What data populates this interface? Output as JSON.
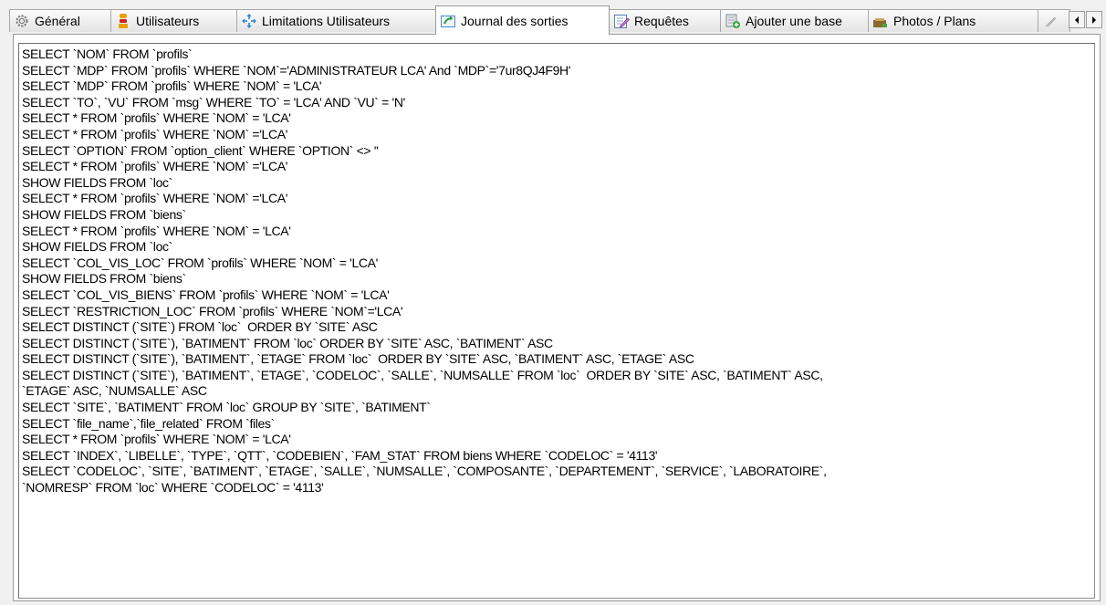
{
  "tabs": [
    {
      "label": "Général",
      "icon": "gear-icon"
    },
    {
      "label": "Utilisateurs",
      "icon": "user-icon"
    },
    {
      "label": "Limitations Utilisateurs",
      "icon": "limit-arrows-icon"
    },
    {
      "label": "Journal des sorties",
      "icon": "export-arrow-icon",
      "active": true
    },
    {
      "label": "Requêtes",
      "icon": "edit-pencil-icon"
    },
    {
      "label": "Ajouter une base",
      "icon": "add-database-icon"
    },
    {
      "label": "Photos / Plans",
      "icon": "photo-icon"
    }
  ],
  "log_lines": [
    "SELECT `NOM` FROM `profils`",
    "SELECT `MDP` FROM `profils` WHERE `NOM`='ADMINISTRATEUR LCA' And `MDP`='7ur8QJ4F9H'",
    "SELECT `MDP` FROM `profils` WHERE `NOM` = 'LCA'",
    "SELECT `TO`, `VU` FROM `msg` WHERE `TO` = 'LCA' AND `VU` = 'N'",
    "SELECT * FROM `profils` WHERE `NOM` = 'LCA'",
    "SELECT * FROM `profils` WHERE `NOM` ='LCA'",
    "SELECT `OPTION` FROM `option_client` WHERE `OPTION` <> ''",
    "SELECT * FROM `profils` WHERE `NOM` ='LCA'",
    "SHOW FIELDS FROM `loc`",
    "SELECT * FROM `profils` WHERE `NOM` ='LCA'",
    "SHOW FIELDS FROM `biens`",
    "SELECT * FROM `profils` WHERE `NOM` = 'LCA'",
    "SHOW FIELDS FROM `loc`",
    "SELECT `COL_VIS_LOC` FROM `profils` WHERE `NOM` = 'LCA'",
    "SHOW FIELDS FROM `biens`",
    "SELECT `COL_VIS_BIENS` FROM `profils` WHERE `NOM` = 'LCA'",
    "SELECT `RESTRICTION_LOC` FROM `profils` WHERE `NOM`='LCA'",
    "SELECT DISTINCT (`SITE`) FROM `loc`  ORDER BY `SITE` ASC",
    "SELECT DISTINCT (`SITE`), `BATIMENT` FROM `loc` ORDER BY `SITE` ASC, `BATIMENT` ASC",
    "SELECT DISTINCT (`SITE`), `BATIMENT`, `ETAGE` FROM `loc`  ORDER BY `SITE` ASC, `BATIMENT` ASC, `ETAGE` ASC",
    "SELECT DISTINCT (`SITE`), `BATIMENT`, `ETAGE`, `CODELOC`, `SALLE`, `NUMSALLE` FROM `loc`  ORDER BY `SITE` ASC, `BATIMENT` ASC,",
    "`ETAGE` ASC, `NUMSALLE` ASC",
    "SELECT `SITE`, `BATIMENT` FROM `loc` GROUP BY `SITE`, `BATIMENT`",
    "SELECT `file_name`,`file_related` FROM `files`",
    "SELECT * FROM `profils` WHERE `NOM` = 'LCA'",
    "SELECT `INDEX`, `LIBELLE`, `TYPE`, `QTT`, `CODEBIEN`, `FAM_STAT` FROM biens WHERE `CODELOC` = '4113'",
    "SELECT `CODELOC`, `SITE`, `BATIMENT`, `ETAGE`, `SALLE`, `NUMSALLE`, `COMPOSANTE`, `DEPARTEMENT`, `SERVICE`, `LABORATOIRE`,",
    "`NOMRESP` FROM `loc` WHERE `CODELOC` = '4113'"
  ]
}
